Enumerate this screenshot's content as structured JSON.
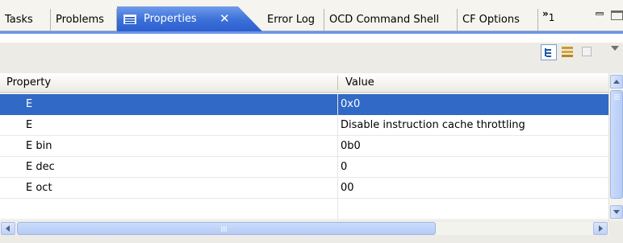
{
  "tabs": [
    {
      "label": "Tasks"
    },
    {
      "label": "Problems"
    },
    {
      "label": "Properties",
      "active": true
    },
    {
      "label": "Error Log"
    },
    {
      "label": "OCD Command Shell"
    },
    {
      "label": "CF Options"
    }
  ],
  "overflow": {
    "chevron": "»",
    "count": "1"
  },
  "table": {
    "headers": {
      "property": "Property",
      "value": "Value"
    },
    "rows": [
      {
        "property": "E",
        "value": "0x0",
        "selected": true
      },
      {
        "property": "E",
        "value": "Disable instruction cache throttling"
      },
      {
        "property": "E bin",
        "value": "0b0"
      },
      {
        "property": "E dec",
        "value": "0"
      },
      {
        "property": "E oct",
        "value": "00"
      },
      {
        "property": "",
        "value": ""
      }
    ]
  },
  "icons": {
    "properties_tab": "properties-icon",
    "close": "close-icon",
    "minimize": "minimize-icon",
    "maximize": "maximize-icon",
    "show_categories": "show-categories-icon",
    "show_advanced": "show-advanced-icon",
    "restore_default": "restore-default-icon",
    "view_menu": "view-menu-icon"
  },
  "colors": {
    "active_tab": "#3b6fd8",
    "selection": "#3069c6",
    "scrollbar": "#c3d5f8"
  }
}
